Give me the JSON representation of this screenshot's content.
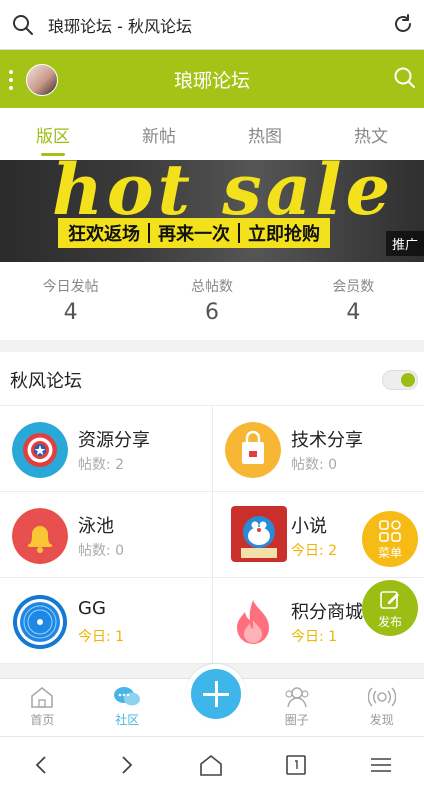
{
  "browser": {
    "title": "琅琊论坛 - 秋风论坛"
  },
  "appbar": {
    "title": "琅琊论坛"
  },
  "tabs": [
    {
      "label": "版区",
      "active": true
    },
    {
      "label": "新帖",
      "active": false
    },
    {
      "label": "热图",
      "active": false
    },
    {
      "label": "热文",
      "active": false
    }
  ],
  "banner": {
    "headline": "hot sale",
    "promo": [
      "狂欢返场",
      "再来一次",
      "立即抢购"
    ],
    "ad_tag": "推广"
  },
  "stats": [
    {
      "label": "今日发帖",
      "value": "4"
    },
    {
      "label": "总帖数",
      "value": "6"
    },
    {
      "label": "会员数",
      "value": "4"
    }
  ],
  "forum": {
    "name": "秋风论坛"
  },
  "boards": [
    {
      "title": "资源分享",
      "sub": "帖数: 2",
      "icon": "captain-shield-icon"
    },
    {
      "title": "技术分享",
      "sub": "帖数: 0",
      "icon": "shopping-bag-icon"
    },
    {
      "title": "泳池",
      "sub": "帖数: 0",
      "icon": "bell-icon"
    },
    {
      "title": "小说",
      "sub": "今日: 2",
      "icon": "doraemon-icon"
    },
    {
      "title": "GG",
      "sub": "今日: 1",
      "icon": "ring-icon"
    },
    {
      "title": "积分商城",
      "sub": "今日: 1",
      "icon": "flame-icon"
    }
  ],
  "fabs": {
    "menu": "菜单",
    "post": "发布"
  },
  "bottomnav": [
    {
      "label": "首页"
    },
    {
      "label": "社区"
    },
    {
      "label": ""
    },
    {
      "label": "圈子"
    },
    {
      "label": "发现"
    }
  ],
  "colors": {
    "brand_green": "#a3c416",
    "accent_blue": "#3fb6ea",
    "gold": "#f6bb14"
  }
}
